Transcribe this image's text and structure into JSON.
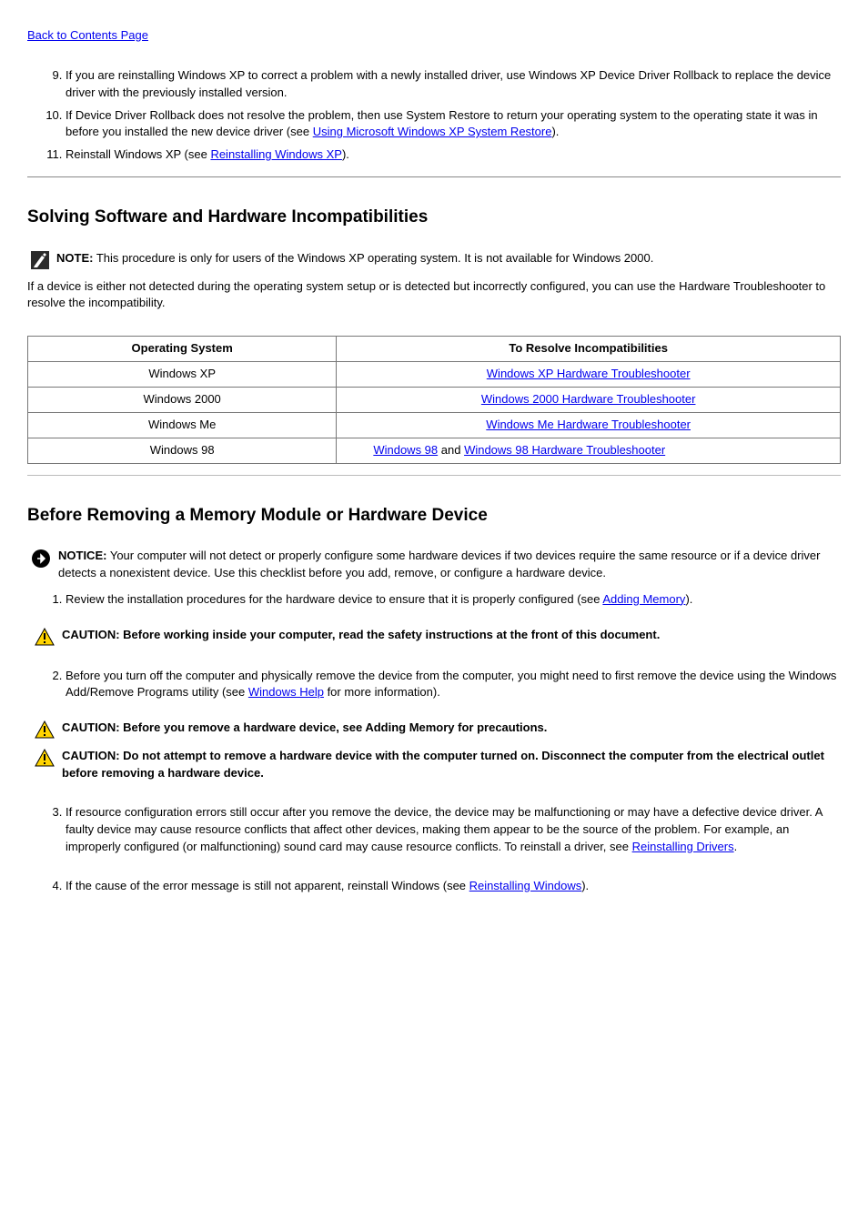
{
  "back_link": "Back to Contents Page",
  "steps_top": [
    {
      "pre": "If you are reinstalling Windows XP to correct a problem with a newly installed driver, use Windows XP Device Driver Rollback to replace the device driver with the previously installed version.",
      "link": ""
    },
    {
      "pre": "If Device Driver Rollback does not resolve the problem, then use System Restore to return your operating system to the operating state it was in before you installed the new device driver (see ",
      "link": "Using Microsoft Windows XP System Restore",
      "post": ")."
    },
    {
      "pre": "Reinstall Windows XP (see ",
      "link": "Reinstalling Windows XP",
      "post": ")."
    }
  ],
  "section1": {
    "heading": "Solving Software and Hardware Incompatibilities",
    "note": "NOTE: This procedure is only for users of the Windows XP operating system. It is not available for Windows 2000.",
    "para": "If a device is either not detected during the operating system setup or is detected but incorrectly configured, you can use the Hardware Troubleshooter to resolve the incompatibility.",
    "table": {
      "header": {
        "col1": "Operating System",
        "col2": "To Resolve Incompatibilities"
      },
      "rows": [
        {
          "col1": "Windows XP",
          "link1": "Windows XP Hardware Troubleshooter"
        },
        {
          "col1": "Windows 2000",
          "link1": "Windows 2000 Hardware Troubleshooter"
        },
        {
          "col1": "Windows Me",
          "link1": "Windows Me Hardware Troubleshooter"
        },
        {
          "col1": "Windows 98",
          "link1_pre": "Windows 98",
          "link1_post": " and ",
          "link2": "Windows 98 Hardware Troubleshooter"
        }
      ]
    }
  },
  "section2": {
    "heading": "Before Removing a Memory Module or Hardware Device",
    "notice": "NOTICE: Your computer will not detect or properly configure some hardware devices if two devices require the same resource or if a device driver detects a nonexistent device. Use this checklist before you add, remove, or configure a hardware device.",
    "step1_pre": "Review the installation procedures for the hardware device to ensure that it is properly configured (see ",
    "step1_link": "Adding Memory",
    "step1_post": ").",
    "warn1_pre": "Before you remove a hardware device, see Adding Memory for precautions.",
    "step2": "Before you turn off the computer and physically remove the device from the computer, you might need to first remove the device using the Windows Add/Remove Programs utility (see ",
    "step2_link": "Windows Help",
    "step2_post": " for more information)."
  },
  "warnings": {
    "w1": "CAUTION: Before working inside your computer, read the safety instructions at the front of this document.",
    "w2": "CAUTION: Do not attempt to remove a hardware device with the computer turned on. Disconnect the computer from the electrical outlet before removing a hardware device."
  },
  "section3": {
    "step3_pre": "If resource configuration errors still occur after you remove the device, the device may be malfunctioning or may have a defective device driver. A faulty device may cause resource conflicts that affect other devices, making them appear to be the source of the problem. For example, an improperly configured (or malfunctioning) sound card may cause resource conflicts. To reinstall a driver, see ",
    "step3_link": "Reinstalling Drivers",
    "step3_post": ".",
    "step4_pre": "If the cause of the error message is still not apparent, reinstall Windows (see ",
    "step4_link": "Reinstalling Windows",
    "step4_post": ")."
  }
}
